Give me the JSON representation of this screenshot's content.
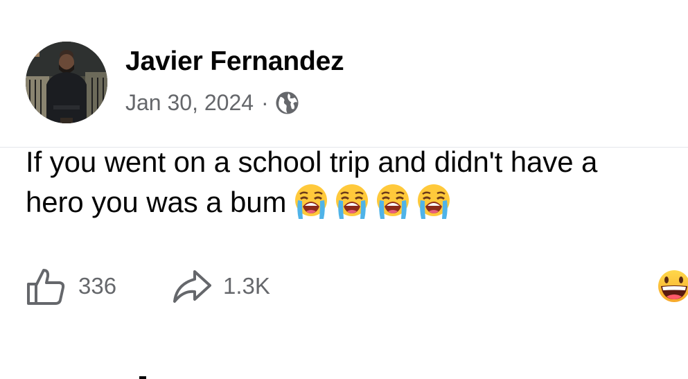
{
  "post": {
    "author": {
      "name": "Javier Fernandez",
      "avatar_icon": "profile-photo"
    },
    "date": "Jan 30, 2024",
    "separator": "·",
    "privacy_icon": "globe-icon",
    "text": {
      "line1": "If you went on a school trip and didn't have a",
      "line2": "hero you was a bum"
    },
    "emojis": [
      "loudly-crying-face",
      "loudly-crying-face",
      "loudly-crying-face",
      "loudly-crying-face"
    ],
    "actions": {
      "like_icon": "thumbs-up-icon",
      "like_count": "336",
      "share_icon": "share-arrow-icon",
      "share_count": "1.3K"
    },
    "reaction_icon": "grinning-face-emoji"
  },
  "colors": {
    "text_primary": "#050505",
    "text_secondary": "#65676b",
    "divider": "#e4e6eb",
    "emoji_yellow": "#ffc93b",
    "tear_blue": "#4fb3e8"
  }
}
